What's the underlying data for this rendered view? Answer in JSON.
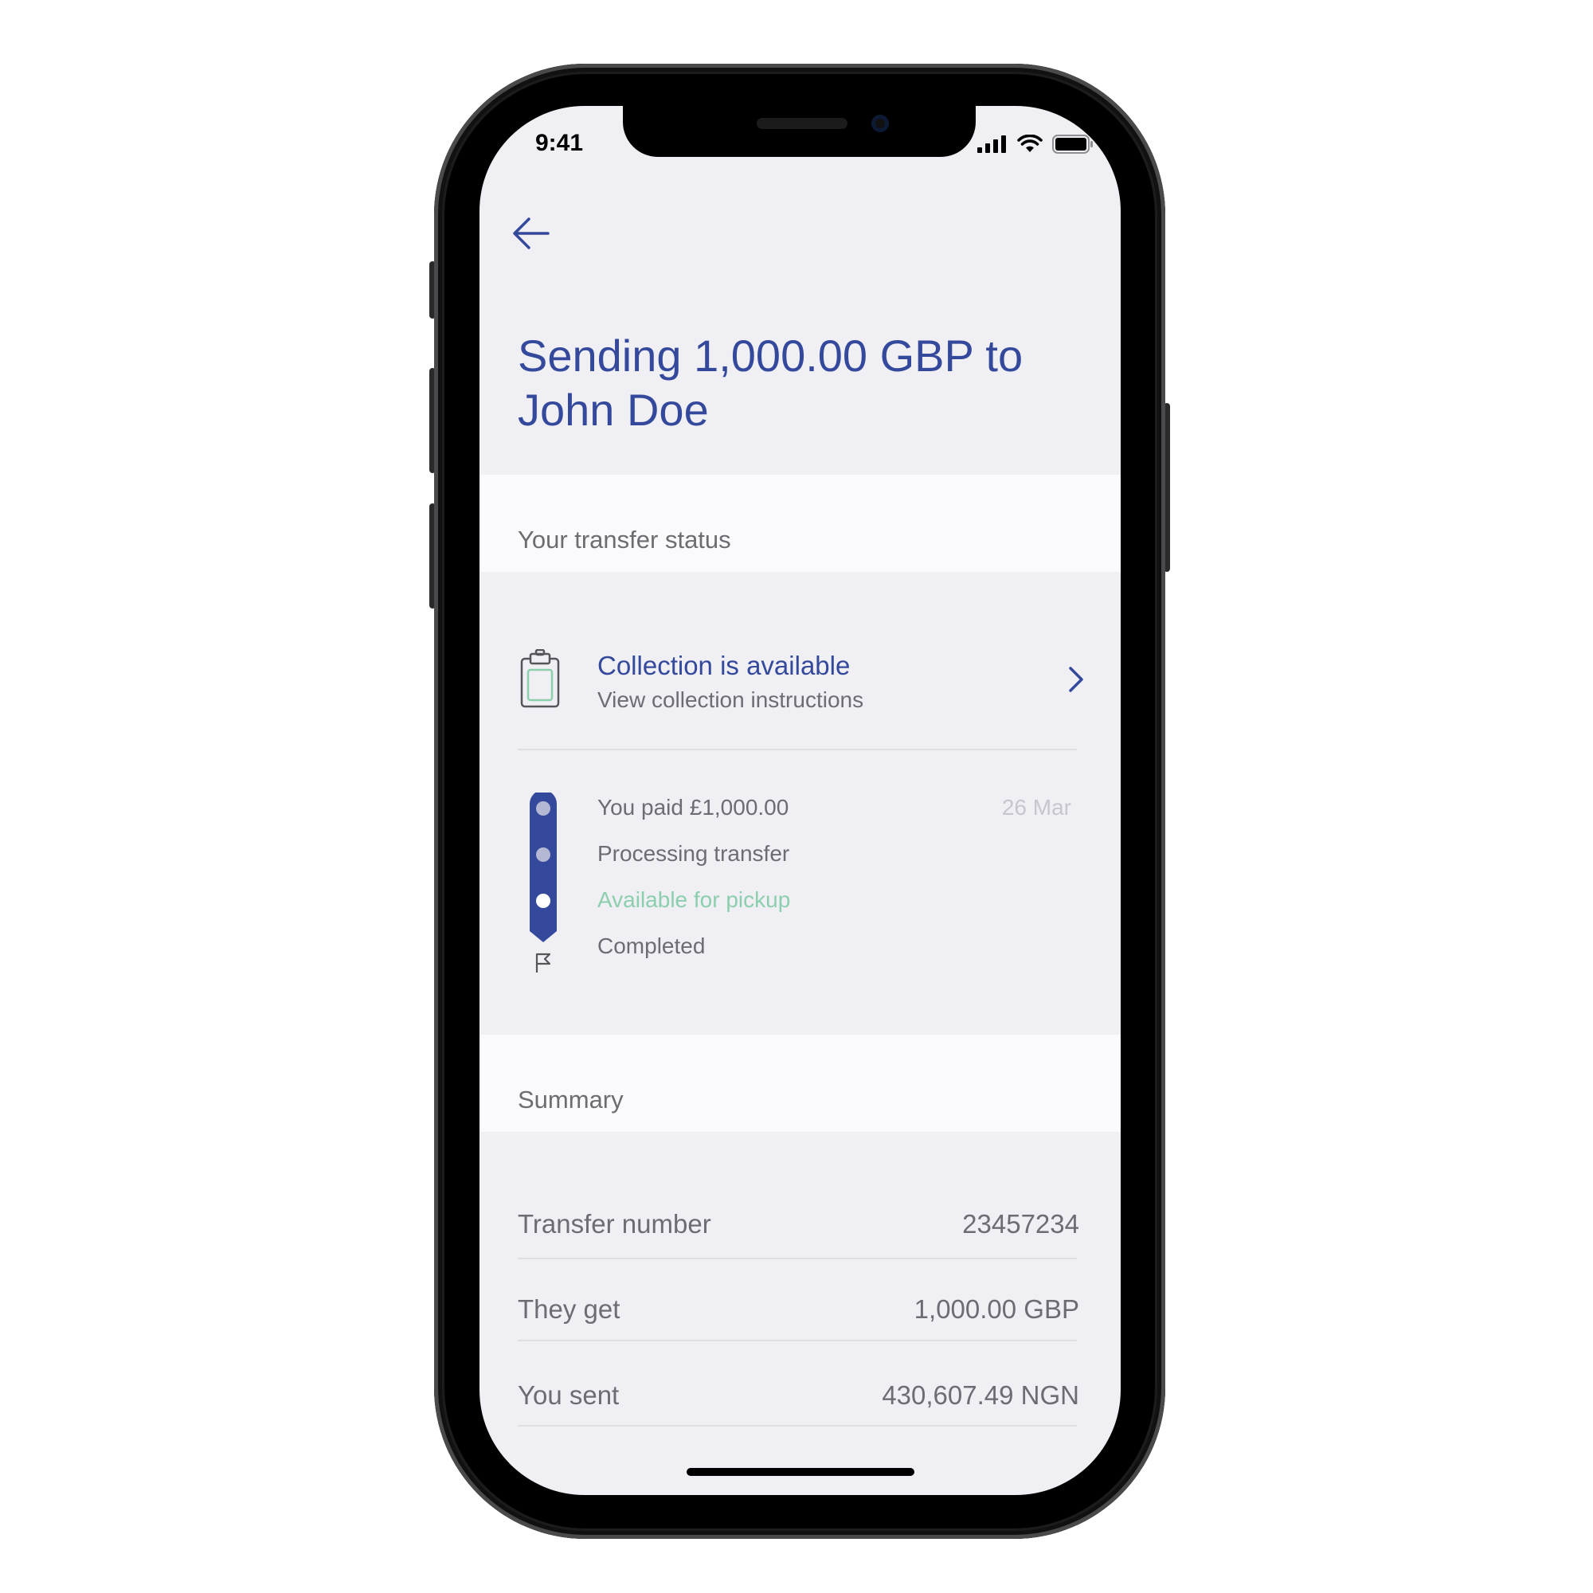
{
  "status_bar": {
    "time": "9:41"
  },
  "header": {
    "title": "Sending 1,000.00 GBP to John Doe"
  },
  "transfer_status": {
    "section_title": "Your transfer status",
    "collection": {
      "title": "Collection is available",
      "subtitle": "View collection instructions"
    },
    "steps": [
      {
        "label": "You paid £1,000.00",
        "date": "26 Mar",
        "state": "done"
      },
      {
        "label": "Processing transfer",
        "state": "done"
      },
      {
        "label": "Available for pickup",
        "state": "current"
      },
      {
        "label": "Completed",
        "state": "pending"
      }
    ]
  },
  "summary": {
    "section_title": "Summary",
    "rows": [
      {
        "label": "Transfer number",
        "value": "23457234"
      },
      {
        "label": "They get",
        "value": "1,000.00 GBP"
      },
      {
        "label": "You sent",
        "value": "430,607.49 NGN"
      }
    ]
  },
  "colors": {
    "primary": "#34499b",
    "success": "#8ccfae",
    "text_secondary": "#6c6c72",
    "background": "#efeff4"
  },
  "icons": [
    "back-arrow-icon",
    "clipboard-icon",
    "chevron-right-icon",
    "flag-icon",
    "signal-icon",
    "wifi-icon",
    "battery-icon"
  ]
}
